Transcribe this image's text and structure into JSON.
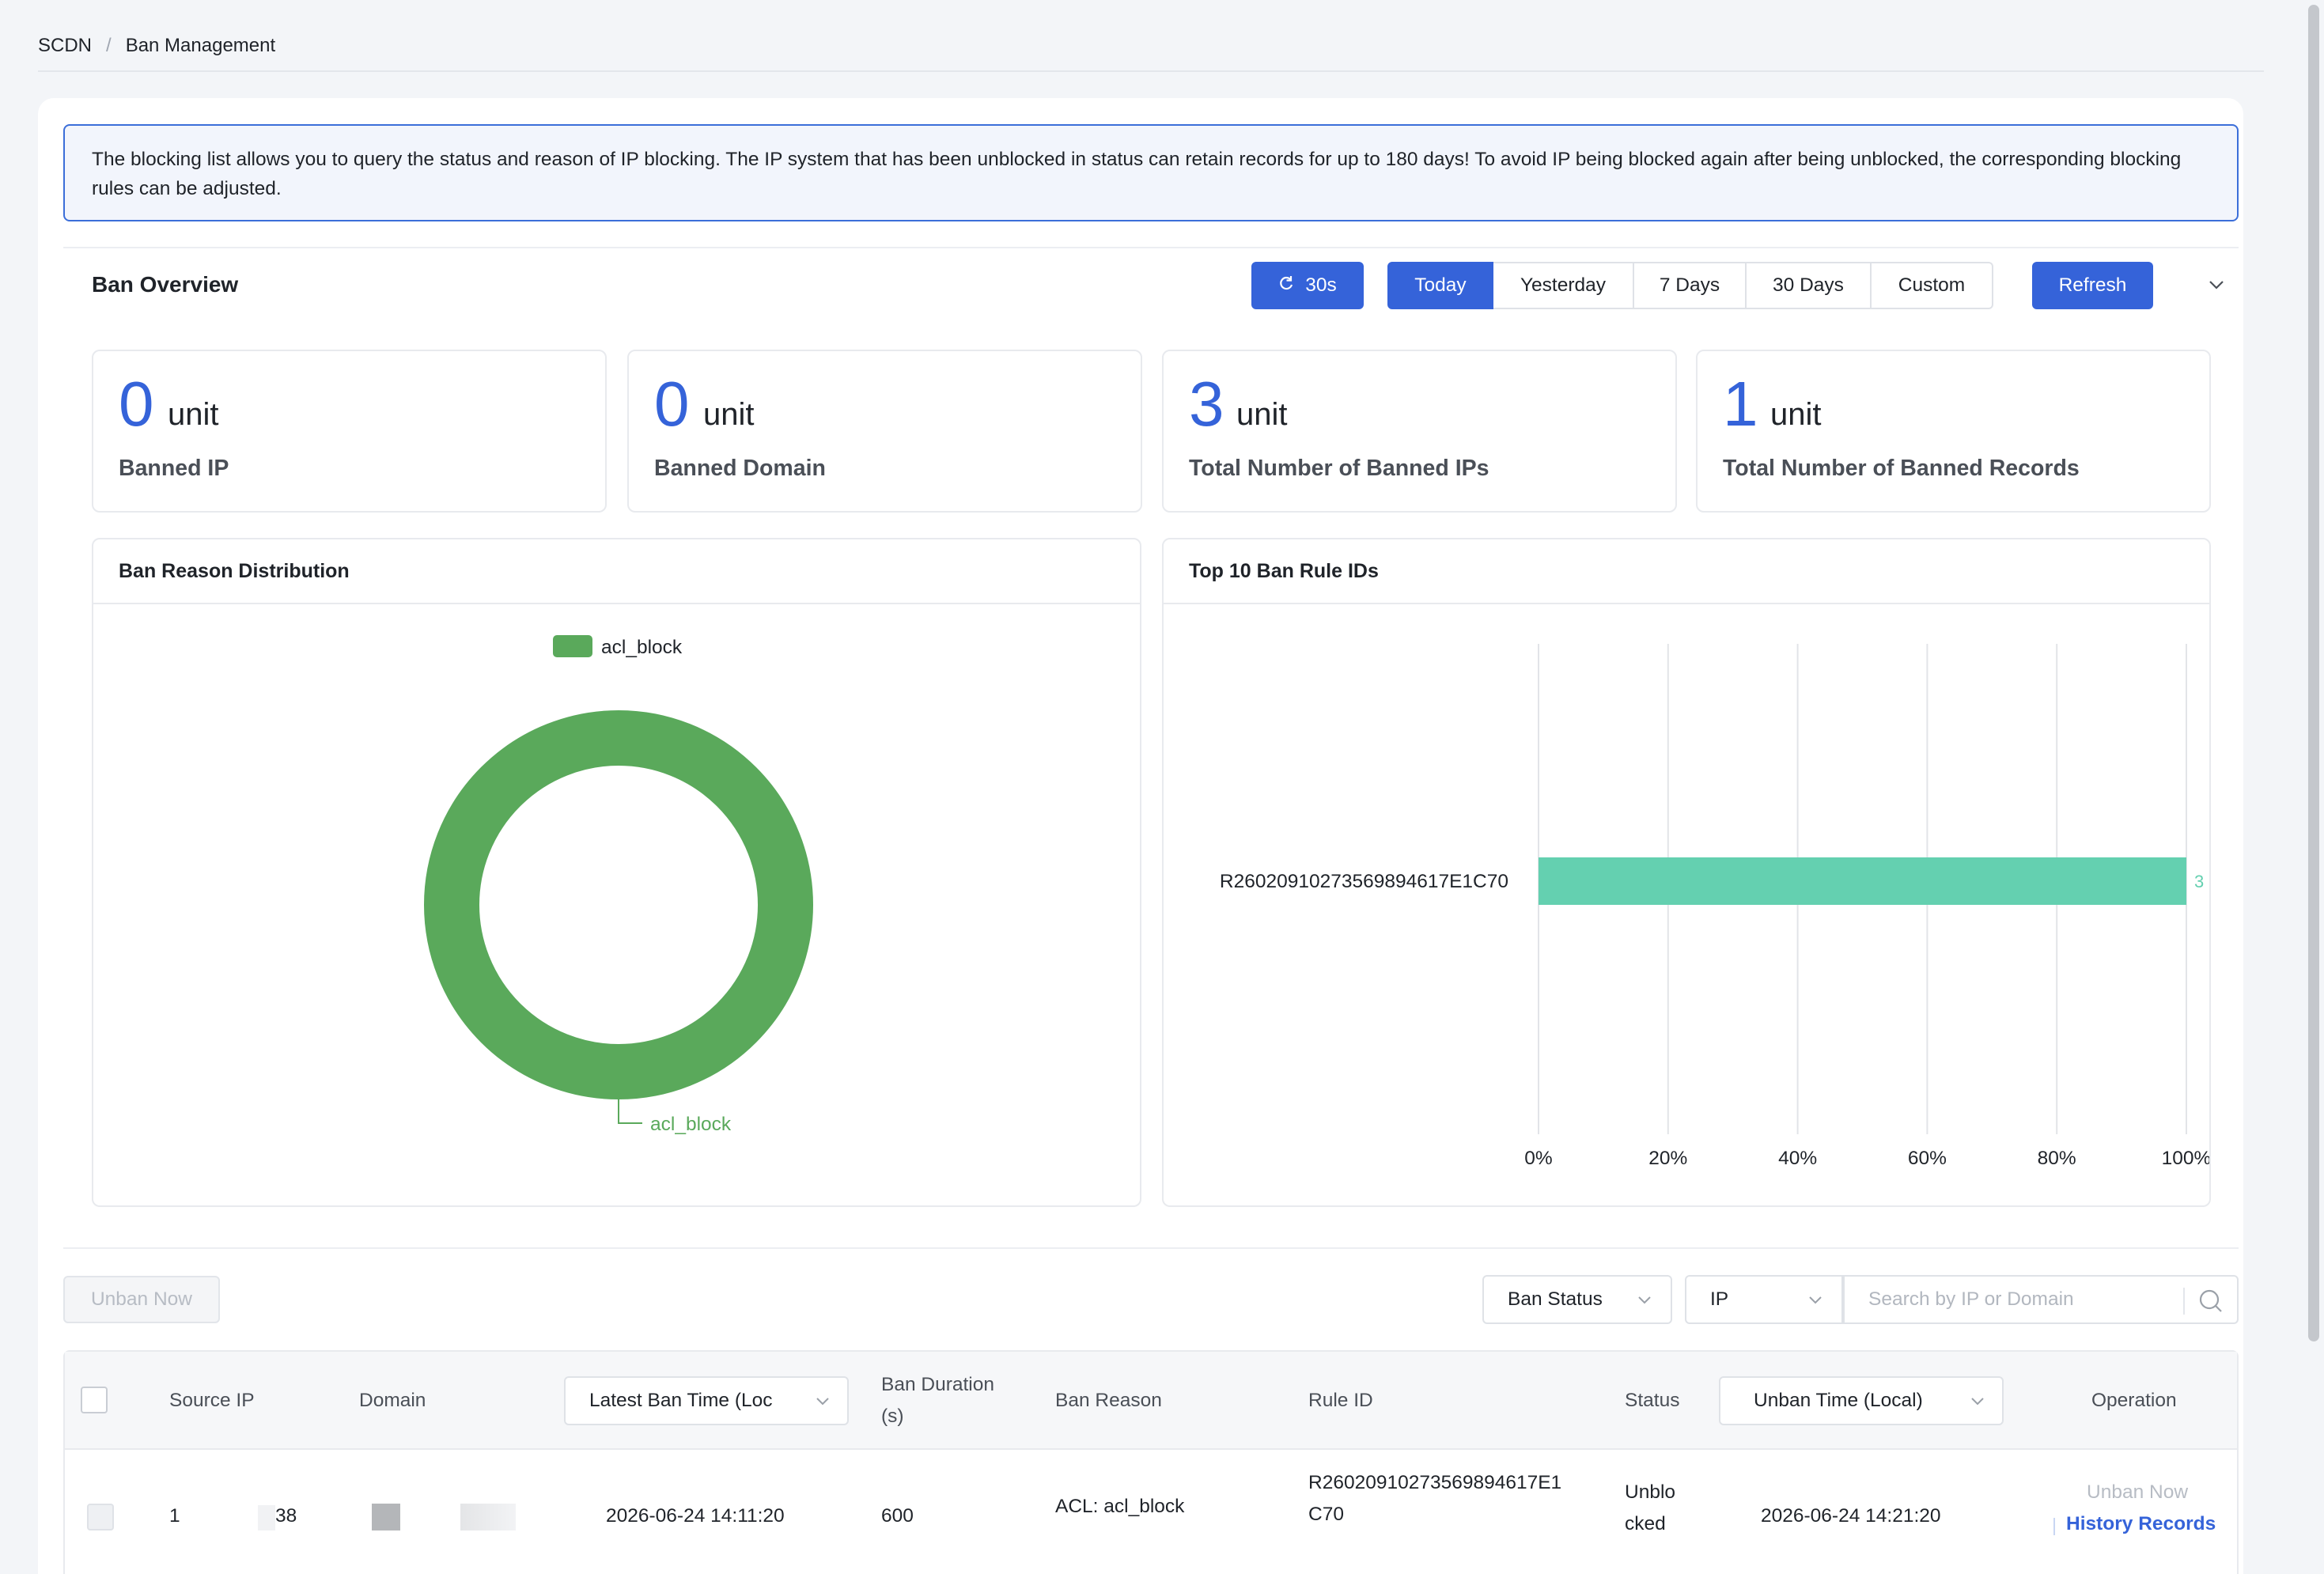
{
  "breadcrumb": {
    "root": "SCDN",
    "separator": "/",
    "current": "Ban Management"
  },
  "notice": {
    "text": "The blocking list allows you to query the status and reason of IP blocking. The IP system that has been unblocked in status can retain records for up to 180 days! To avoid IP being blocked again after being unblocked, the corresponding blocking rules can be adjusted."
  },
  "overview": {
    "title": "Ban Overview",
    "auto_refresh_label": "30s",
    "ranges": [
      "Today",
      "Yesterday",
      "7 Days",
      "30 Days",
      "Custom"
    ],
    "active_range": "Today",
    "refresh_label": "Refresh"
  },
  "stats": [
    {
      "value": "0",
      "unit": "unit",
      "label": "Banned IP"
    },
    {
      "value": "0",
      "unit": "unit",
      "label": "Banned Domain"
    },
    {
      "value": "3",
      "unit": "unit",
      "label": "Total Number of Banned IPs"
    },
    {
      "value": "1",
      "unit": "unit",
      "label": "Total Number of Banned Records"
    }
  ],
  "chart_data": [
    {
      "type": "pie",
      "title": "Ban Reason Distribution",
      "legend": [
        "acl_block"
      ],
      "legend_position": "top",
      "slices": [
        {
          "name": "acl_block",
          "value": 100,
          "color": "#5aa95b"
        }
      ],
      "slice_label": "acl_block"
    },
    {
      "type": "bar",
      "orientation": "horizontal",
      "title": "Top 10 Ban Rule IDs",
      "categories": [
        "R2602091027356989461 7E1C70"
      ],
      "values": [
        3
      ],
      "value_labels": [
        "3",
        "100"
      ],
      "percent": [
        100
      ],
      "x_ticks": [
        "0%",
        "20%",
        "40%",
        "60%",
        "80%",
        "100%"
      ],
      "xlim": [
        0,
        100
      ],
      "grid": true,
      "bar_color": "#64d0b0"
    }
  ],
  "filters": {
    "unban_now_label": "Unban Now",
    "ban_status_label": "Ban Status",
    "search_type_label": "IP",
    "search_placeholder": "Search by IP or Domain"
  },
  "table": {
    "headers": {
      "source_ip": "Source IP",
      "domain": "Domain",
      "latest_ban_time": "Latest Ban Time (Loc",
      "ban_duration_1": "Ban Duration",
      "ban_duration_2": "(s)",
      "ban_reason": "Ban Reason",
      "rule_id": "Rule ID",
      "status": "Status",
      "unban_time": "Unban Time (Local)",
      "operation": "Operation"
    },
    "rows": [
      {
        "source_ip_start": "1",
        "source_ip_end": "38",
        "latest_ban_time": "2026-06-24 14:11:20",
        "ban_duration": "600",
        "ban_reason": "ACL: acl_block",
        "rule_id_1": "R26020910273569894617E1",
        "rule_id_2": "C70",
        "status_1": "Unblo",
        "status_2": "cked",
        "unban_time": "2026-06-24 14:21:20",
        "op_unban": "Unban Now",
        "op_history": "History Records"
      }
    ]
  }
}
